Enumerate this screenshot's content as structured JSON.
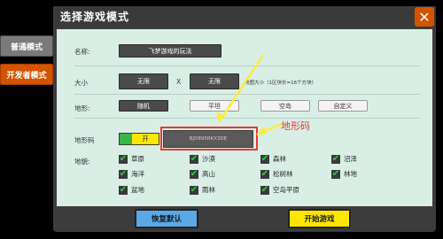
{
  "side_tabs": [
    {
      "label": "普通模式"
    },
    {
      "label": "开发者模式"
    }
  ],
  "dialog": {
    "title": "选择游戏模式",
    "close_symbol": "✕"
  },
  "fields": {
    "name_label": "名称:",
    "name_value": "飞梦游戏的玩法",
    "size_label": "大小",
    "size_x": "无限",
    "size_sep": "X",
    "size_y": "无限",
    "size_hint": "地图大小（1区块长=16个方块）",
    "terrain_label": "地形:",
    "terrain_options": [
      "随机",
      "平坦",
      "空岛",
      "自定义"
    ],
    "code_label": "地形码",
    "code_toggle": "开",
    "code_value": "BJD895RKX3DE",
    "biome_label": "地貌:"
  },
  "biomes": [
    {
      "label": "草原",
      "checked": true
    },
    {
      "label": "沙漠",
      "checked": true
    },
    {
      "label": "森林",
      "checked": true
    },
    {
      "label": "沼泽",
      "checked": true
    },
    {
      "label": "海洋",
      "checked": true
    },
    {
      "label": "高山",
      "checked": true
    },
    {
      "label": "松树林",
      "checked": true
    },
    {
      "label": "林地",
      "checked": true
    },
    {
      "label": "盆地",
      "checked": true
    },
    {
      "label": "雨林",
      "checked": true
    },
    {
      "label": "空岛平原",
      "checked": true
    }
  ],
  "annotation": "地形码",
  "footer": {
    "reset_label": "恢复默认",
    "start_label": "开始游戏"
  },
  "colors": {
    "accent_orange": "#d35400",
    "panel_bg": "#d9efe6",
    "highlight_red": "#e53935",
    "arrow_yellow": "#ffeb3b"
  }
}
